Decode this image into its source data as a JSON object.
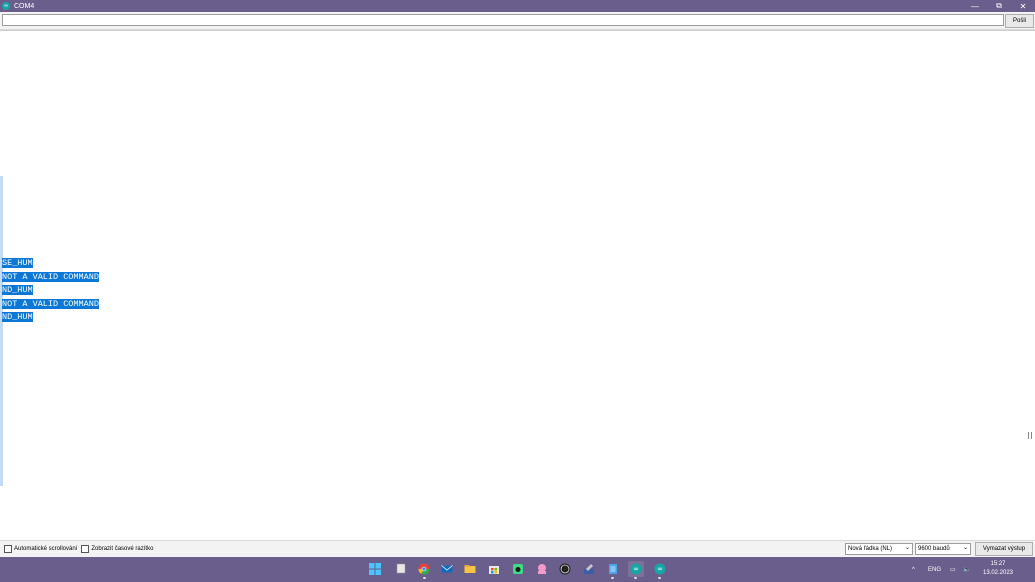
{
  "window": {
    "title": "COM4",
    "minimize_glyph": "—",
    "maximize_glyph": "⧉",
    "close_glyph": "✕"
  },
  "send": {
    "input_value": "",
    "button_label": "Pošli"
  },
  "output": {
    "lines": [
      "SE_HUM",
      "NOT A VALID COMMAND",
      "ND_HUM",
      "NOT A VALID COMMAND",
      "ND_HUM"
    ]
  },
  "footer": {
    "autoscroll_label": "Automatické scrollování",
    "timestamp_label": "Zobrazit časové razítko",
    "line_ending": "Nová řádka (NL)",
    "baud": "9600 baudů",
    "clear_button": "Vymazat výstup"
  },
  "taskbar": {
    "language": "ENG",
    "time": "15:27",
    "date": "13.02.2023",
    "apps": [
      "windows-start-icon",
      "file-explorer-window-icon",
      "chrome-icon",
      "mail-icon",
      "folder-icon",
      "store-icon",
      "android-icon",
      "octopus-app-icon",
      "obs-icon",
      "tool-icon",
      "notepad-icon",
      "arduino-icon",
      "arduino-icon-2"
    ]
  },
  "colors": {
    "accent": "#6a5f8c",
    "selection": "#0b78d7",
    "arduino": "#15a6a6"
  }
}
